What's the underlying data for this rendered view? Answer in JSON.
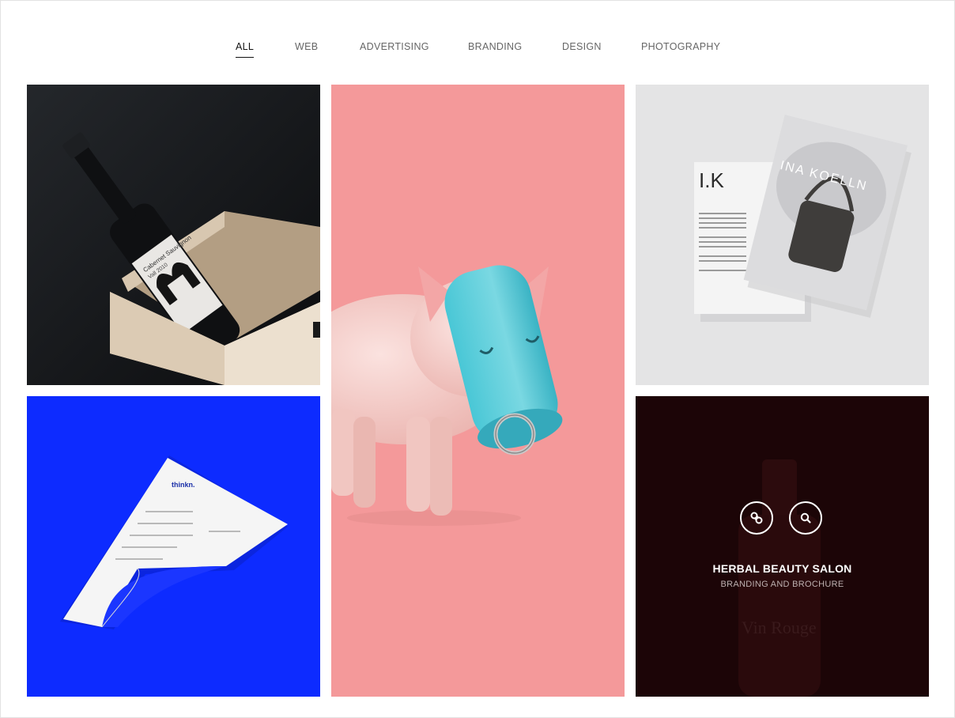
{
  "filters": [
    {
      "label": "ALL",
      "active": true
    },
    {
      "label": "WEB",
      "active": false
    },
    {
      "label": "ADVERTISING",
      "active": false
    },
    {
      "label": "BRANDING",
      "active": false
    },
    {
      "label": "DESIGN",
      "active": false
    },
    {
      "label": "PHOTOGRAPHY",
      "active": false
    }
  ],
  "tiles": [
    {
      "image": "wine-bottle-in-wooden-box",
      "bg": "#141619",
      "label_text": "Cabernet Sauvignon",
      "label_year": "Vall 2010"
    },
    {
      "image": "pink-pig-with-blue-snout-cap",
      "bg": "#f4999a"
    },
    {
      "image": "magazine-brochure-mockup",
      "bg": "#e2e2e3",
      "logo_text": "I.K",
      "cover_text": "INA KOELLN"
    },
    {
      "image": "letterhead-paper-curl",
      "bg": "#0d2bff",
      "brand_text": "thinkn."
    },
    {
      "image": "wine-bottle-dark-overlay",
      "bg": "#1c0507",
      "bottle_text": "Vin Rouge",
      "overlay": {
        "title": "HERBAL BEAUTY SALON",
        "subtitle": "BRANDING AND BROCHURE"
      }
    }
  ],
  "icons": {
    "link": "link-icon",
    "search": "search-icon"
  },
  "colors": {
    "accent_text": "#111111",
    "filter_text": "#666666",
    "overlay_bg": "#1c0507"
  }
}
